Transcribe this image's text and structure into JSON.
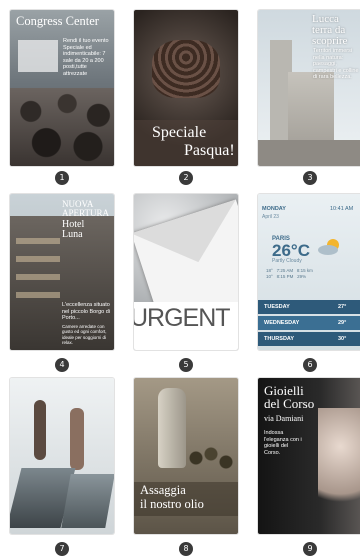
{
  "cards": [
    {
      "number": "1",
      "title": "Congress Center",
      "text": "Rendi il tuo evento Speciale ed indimenticabile: 7 sale da 20 a 200 posti,tutte attrezzate"
    },
    {
      "number": "2",
      "line1": "Speciale",
      "line2": "Pasqua!"
    },
    {
      "number": "3",
      "title_line1": "Lucca",
      "title_line2": "terra da",
      "title_line3": "scoprire",
      "text": "Territori immersi nella natura: paesaggi, campestri e colline di rara bellezza."
    },
    {
      "number": "4",
      "line1": "NUOVA",
      "line2": "APERTURA",
      "line3": "Hotel",
      "line4": "Luna",
      "text": "L'eccellenza situato nel piccolo Borgo di Porto...",
      "text_small": "Camere arredate con gusto ed ogni comfort, ideale per soggiorni di relax."
    },
    {
      "number": "5",
      "word": "URGENT"
    },
    {
      "number": "6",
      "day": "MONDAY",
      "time": "10:41 AM",
      "date": "April 23",
      "city": "PARIS",
      "temperature": "26°C",
      "condition": "Partly Cloudy",
      "stats": [
        "18°",
        "7:25 AM",
        "8:15 km",
        "10°",
        "8:15 PM",
        "29%"
      ],
      "forecast": [
        {
          "day": "TUESDAY",
          "temp": "27°"
        },
        {
          "day": "WEDNESDAY",
          "temp": "29°"
        },
        {
          "day": "THURSDAY",
          "temp": "30°"
        }
      ]
    },
    {
      "number": "7"
    },
    {
      "number": "8",
      "line1": "Assaggia",
      "line2": "il nostro olio"
    },
    {
      "number": "9",
      "title_line1": "Gioielli",
      "title_line2": "del Corso",
      "subtitle": "via Damiani",
      "text": "Indossa l'eleganza con i gioielli del Corso."
    }
  ]
}
